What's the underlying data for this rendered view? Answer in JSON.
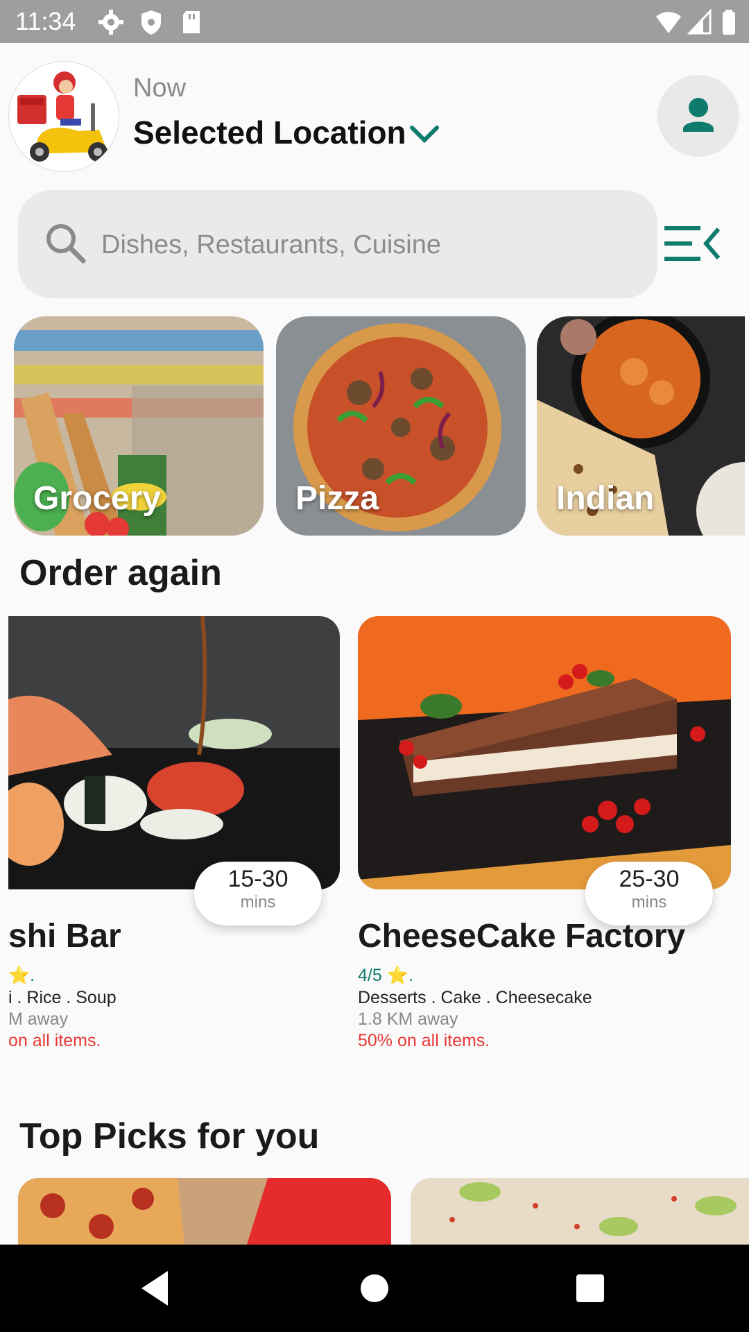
{
  "status_bar": {
    "time": "11:34"
  },
  "header": {
    "delivery_time": "Now",
    "location": "Selected Location"
  },
  "search": {
    "placeholder": "Dishes, Restaurants, Cuisine"
  },
  "categories": [
    {
      "label": "Grocery"
    },
    {
      "label": "Pizza"
    },
    {
      "label": "Indian"
    }
  ],
  "order_again": {
    "title": "Order again",
    "restaurants": [
      {
        "name": "shi Bar",
        "delivery_time": "15-30",
        "delivery_unit": "mins",
        "rating": "⭐.",
        "tags": "i . Rice . Soup",
        "distance": "M away",
        "offer": "on all items."
      },
      {
        "name": "CheeseCake Factory",
        "delivery_time": "25-30",
        "delivery_unit": "mins",
        "rating": "4/5 ⭐.",
        "tags": "Desserts . Cake . Cheesecake",
        "distance": "1.8 KM away",
        "offer": "50% on all items."
      }
    ]
  },
  "top_picks": {
    "title": "Top Picks for you"
  },
  "colors": {
    "accent": "#0f7b6c",
    "offer": "#e53935",
    "background": "#fafafa"
  }
}
